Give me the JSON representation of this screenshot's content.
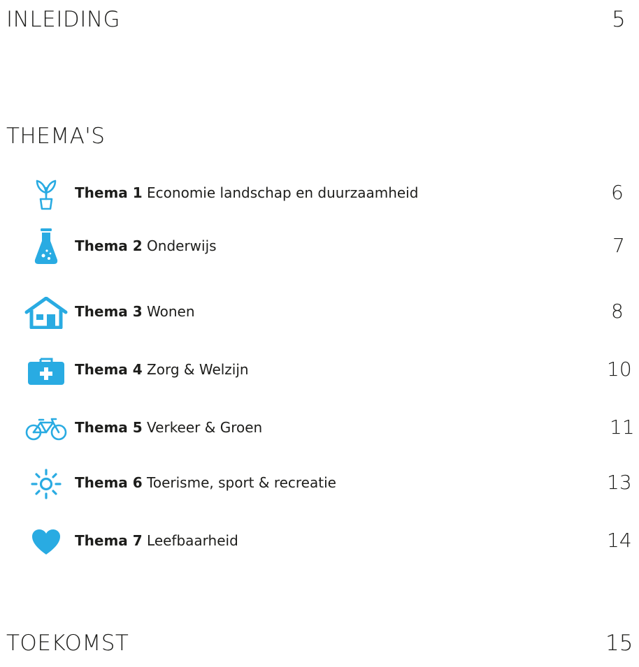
{
  "sections": {
    "intro": {
      "title": "INLEIDING",
      "page": "5"
    },
    "themes": {
      "title": "THEMA'S"
    },
    "future": {
      "title": "TOEKOMST",
      "page": "15"
    }
  },
  "accent_color": "#29abe2",
  "themes": [
    {
      "label": "Thema 1",
      "title": "Economie landschap en duurzaamheid",
      "page": "6",
      "icon": "seedling-icon"
    },
    {
      "label": "Thema 2",
      "title": "Onderwijs",
      "page": "7",
      "icon": "flask-icon"
    },
    {
      "label": "Thema 3",
      "title": "Wonen",
      "page": "8",
      "icon": "house-icon"
    },
    {
      "label": "Thema 4",
      "title": "Zorg & Welzijn",
      "page": "10",
      "icon": "medical-kit-icon"
    },
    {
      "label": "Thema 5",
      "title": "Verkeer & Groen",
      "page": "11",
      "icon": "bicycle-icon"
    },
    {
      "label": "Thema 6",
      "title": "Toerisme, sport & recreatie",
      "page": "13",
      "icon": "sun-icon"
    },
    {
      "label": "Thema 7",
      "title": "Leefbaarheid",
      "page": "14",
      "icon": "heart-icon"
    }
  ]
}
